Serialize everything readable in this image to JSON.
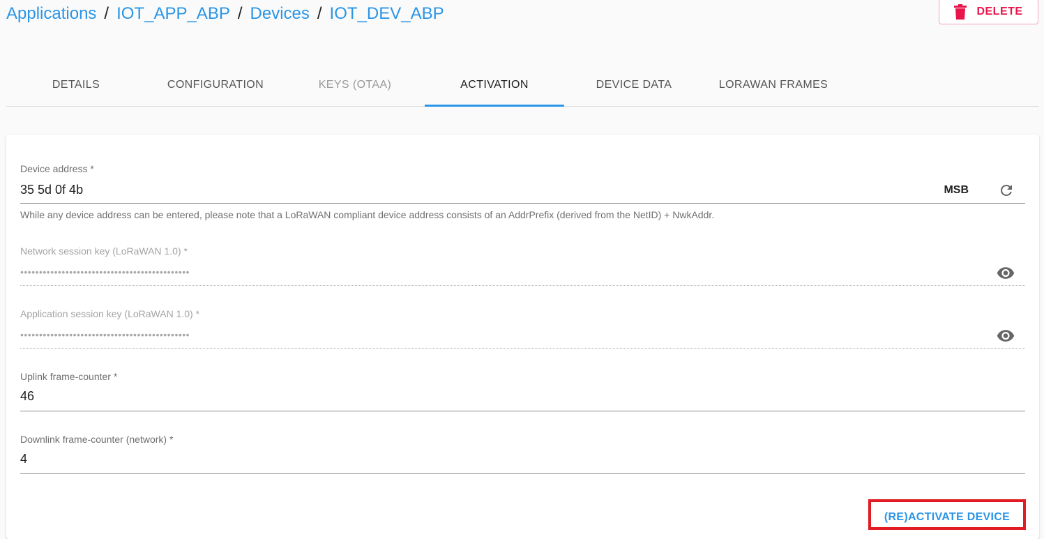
{
  "breadcrumb": {
    "items": [
      "Applications",
      "IOT_APP_ABP",
      "Devices",
      "IOT_DEV_ABP"
    ],
    "separator": "/"
  },
  "header": {
    "delete_label": "DELETE",
    "delete_icon": "trash-icon"
  },
  "tabs": [
    {
      "label": "DETAILS",
      "state": "normal"
    },
    {
      "label": "CONFIGURATION",
      "state": "normal"
    },
    {
      "label": "KEYS (OTAA)",
      "state": "disabled"
    },
    {
      "label": "ACTIVATION",
      "state": "active"
    },
    {
      "label": "DEVICE DATA",
      "state": "normal"
    },
    {
      "label": "LORAWAN FRAMES",
      "state": "normal"
    }
  ],
  "form": {
    "device_address": {
      "label": "Device address *",
      "value": "35 5d 0f 4b",
      "byte_order": "MSB",
      "helper": "While any device address can be entered, please note that a LoRaWAN compliant device address consists of an AddrPrefix (derived from the NetID) + NwkAddr."
    },
    "nwk_session_key": {
      "label": "Network session key (LoRaWAN 1.0) *",
      "value": "•••••••••••••••••••••••••••••••••••••••••••••"
    },
    "app_session_key": {
      "label": "Application session key (LoRaWAN 1.0) *",
      "value": "•••••••••••••••••••••••••••••••••••••••••••••"
    },
    "uplink_counter": {
      "label": "Uplink frame-counter *",
      "value": "46"
    },
    "downlink_counter": {
      "label": "Downlink frame-counter (network) *",
      "value": "4"
    }
  },
  "actions": {
    "activate_label": "(RE)ACTIVATE DEVICE"
  },
  "colors": {
    "primary": "#2a95e6",
    "danger": "#e8154a",
    "highlight": "#e21b25"
  },
  "icons": [
    "trash-icon",
    "refresh-icon",
    "eye-icon"
  ]
}
